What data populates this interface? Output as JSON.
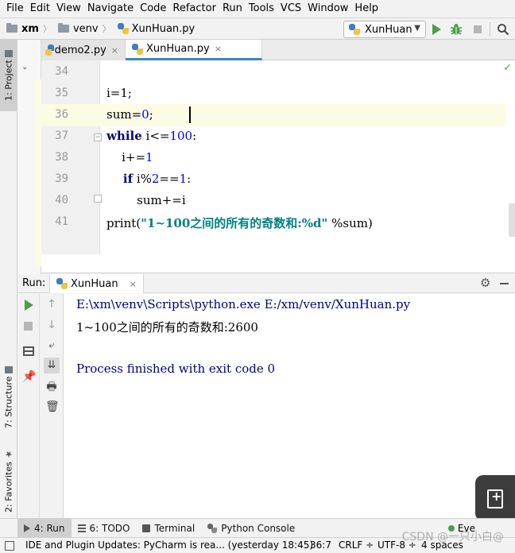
{
  "menu": [
    "File",
    "Edit",
    "View",
    "Navigate",
    "Code",
    "Refactor",
    "Run",
    "Tools",
    "VCS",
    "Window",
    "Help"
  ],
  "breadcrumb": {
    "project": "xm",
    "folder": "venv",
    "file": "XunHuan.py"
  },
  "run_config": {
    "name": "XunHuan"
  },
  "project_tab": "1: Project",
  "editor_tabs": [
    {
      "label": "demo2.py",
      "close": "×"
    },
    {
      "label": "XunHuan.py",
      "close": "×"
    }
  ],
  "editor": {
    "lines": [
      {
        "num": "34"
      },
      {
        "num": "35"
      },
      {
        "num": "36"
      },
      {
        "num": "37"
      },
      {
        "num": "38"
      },
      {
        "num": "39"
      },
      {
        "num": "40"
      },
      {
        "num": "41"
      }
    ],
    "code": {
      "l35": "i=1;",
      "l36_pre": "sum=",
      "l36_num": "0",
      "l36_post": ";",
      "l37_kw": "while",
      "l37_mid": " i<=",
      "l37_num": "100",
      "l37_post": ":",
      "l38_pre": "    i+=",
      "l38_num": "1",
      "l39_kw": "    if",
      "l39_mid": " i%",
      "l39_num1": "2",
      "l39_eq": "==",
      "l39_num2": "1",
      "l39_post": ":",
      "l40": "        sum+=i",
      "l41_pre": "print(",
      "l41_str": "\"1~100之间的所有的奇数和:%d\"",
      "l41_post": " %sum)"
    }
  },
  "run_panel": {
    "label": "Run:",
    "tab": "XunHuan",
    "tab_close": "×"
  },
  "console": {
    "command": "E:\\xm\\venv\\Scripts\\python.exe E:/xm/venv/XunHuan.py",
    "output": "1~100之间的所有的奇数和:2600",
    "exit": "Process finished with exit code 0"
  },
  "side_tabs": {
    "structure": "7: Structure",
    "favorites": "2: Favorites"
  },
  "bottom_tabs": {
    "run": "4: Run",
    "todo": "6: TODO",
    "terminal": "Terminal",
    "console": "Python Console",
    "event": "Eve"
  },
  "status": {
    "message": "IDE and Plugin Updates: PyCharm is rea... (yesterday 18:45)",
    "position": "36:7",
    "line_sep": "CRLF ÷",
    "encoding": "UTF-8 ÷",
    "indent": "4 spaces"
  },
  "watermark": "CSDN @一只小白@",
  "colors": {
    "keyword": "#000080",
    "number": "#0000ff",
    "string": "#008080",
    "run_green": "#48a146",
    "tab_accent": "#4083c9"
  }
}
